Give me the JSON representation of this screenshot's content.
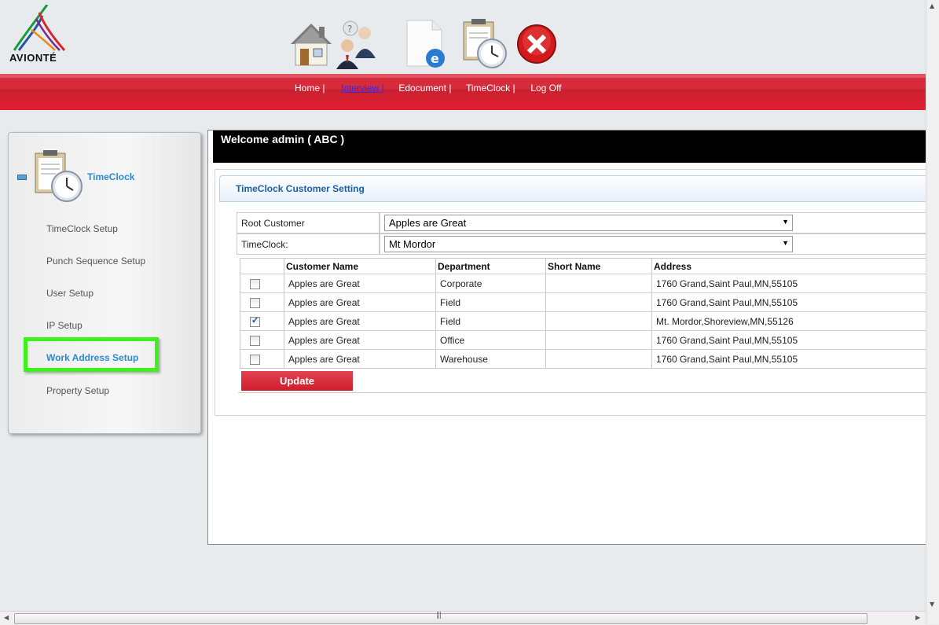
{
  "brand": {
    "name": "AVIONTÉ"
  },
  "toolbar_icons": [
    {
      "name": "home-icon"
    },
    {
      "name": "interview-icon"
    },
    {
      "name": "edocument-icon"
    },
    {
      "name": "timeclock-icon"
    },
    {
      "name": "logoff-icon"
    }
  ],
  "nav": {
    "home": "Home |",
    "interview": "Interview |",
    "edocument": "Edocument |",
    "timeclock": "TimeClock |",
    "logoff": "Log Off"
  },
  "sidebar": {
    "title": "TimeClock",
    "items": [
      {
        "label": "TimeClock Setup"
      },
      {
        "label": "Punch Sequence Setup"
      },
      {
        "label": "User Setup"
      },
      {
        "label": "IP Setup"
      },
      {
        "label": "Work Address Setup"
      },
      {
        "label": "Property Setup"
      }
    ]
  },
  "main": {
    "welcome": "Welcome admin ( ABC )",
    "panel_title": "TimeClock Customer Setting",
    "root_customer_label": "Root Customer",
    "root_customer_value": "Apples are Great",
    "timeclock_label": "TimeClock:",
    "timeclock_value": "Mt Mordor",
    "columns": [
      "Customer Name",
      "Department",
      "Short Name",
      "Address"
    ],
    "rows": [
      {
        "checked": false,
        "customer": "Apples are Great",
        "department": "Corporate",
        "short": "",
        "address": "1760 Grand,Saint Paul,MN,55105"
      },
      {
        "checked": false,
        "customer": "Apples are Great",
        "department": "Field",
        "short": "",
        "address": "1760 Grand,Saint Paul,MN,55105"
      },
      {
        "checked": true,
        "customer": "Apples are Great",
        "department": "Field",
        "short": "",
        "address": "Mt. Mordor,Shoreview,MN,55126"
      },
      {
        "checked": false,
        "customer": "Apples are Great",
        "department": "Office",
        "short": "",
        "address": "1760 Grand,Saint Paul,MN,55105"
      },
      {
        "checked": false,
        "customer": "Apples are Great",
        "department": "Warehouse",
        "short": "",
        "address": "1760 Grand,Saint Paul,MN,55105"
      }
    ],
    "update_label": "Update"
  },
  "colors": {
    "header_red": "#d52b3b",
    "highlight_green": "#3df21a",
    "link_blue": "#2a8ad0",
    "button_red": "#d9293a"
  }
}
